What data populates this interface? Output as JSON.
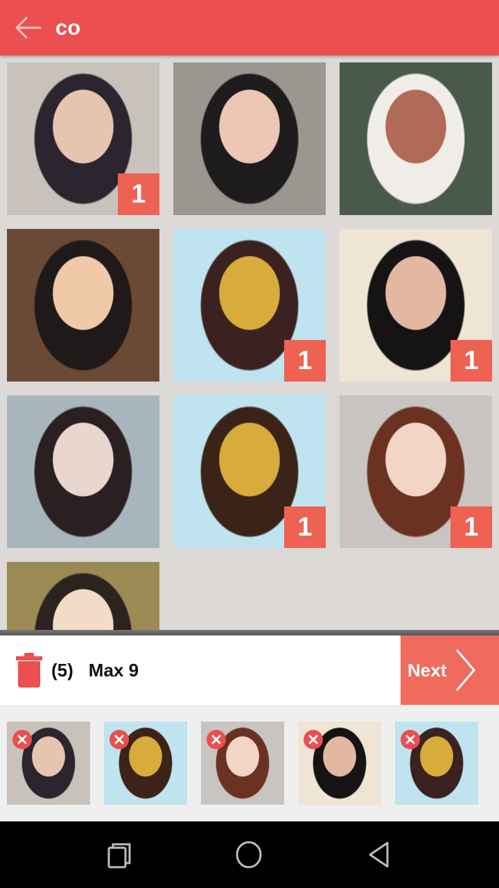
{
  "topbar": {
    "title": "co",
    "back_icon": "arrow-left-icon"
  },
  "grid": {
    "photos": [
      {
        "id": "photo-1",
        "selected_count": "1",
        "palette": [
          "#c9c2ba",
          "#2b2530",
          "#e7c4b0"
        ]
      },
      {
        "id": "photo-2",
        "selected_count": "",
        "palette": [
          "#9a9690",
          "#1e1b1c",
          "#ecc8b4"
        ]
      },
      {
        "id": "photo-3",
        "selected_count": "",
        "palette": [
          "#4a5a4a",
          "#f0ede8",
          "#b06a55"
        ]
      },
      {
        "id": "photo-4",
        "selected_count": "",
        "palette": [
          "#6b4a35",
          "#20191a",
          "#f0c9a8"
        ]
      },
      {
        "id": "photo-5",
        "selected_count": "1",
        "palette": [
          "#bfe3ef",
          "#3b2220",
          "#d8ac3a"
        ]
      },
      {
        "id": "photo-6",
        "selected_count": "1",
        "palette": [
          "#efe5d4",
          "#161314",
          "#e2b8a0"
        ]
      },
      {
        "id": "photo-7",
        "selected_count": "",
        "palette": [
          "#a9b5bd",
          "#2a2022",
          "#e9d6cf"
        ]
      },
      {
        "id": "photo-8",
        "selected_count": "1",
        "palette": [
          "#bfe3ef",
          "#3c2318",
          "#d8ac3a"
        ]
      },
      {
        "id": "photo-9",
        "selected_count": "1",
        "palette": [
          "#c8c4c2",
          "#6b3222",
          "#f2d5c4"
        ]
      },
      {
        "id": "photo-10",
        "selected_count": "",
        "palette": [
          "#9c8a55",
          "#2a2320",
          "#f2dcc8"
        ]
      }
    ]
  },
  "actionbar": {
    "delete_icon": "trash-icon",
    "selected_count": "(5)",
    "max_label": "Max 9",
    "next_label": "Next",
    "next_icon": "chevron-right-icon",
    "accent_color": "#ef6b5d"
  },
  "tray": {
    "selected": [
      {
        "id": "photo-1",
        "palette": [
          "#c9c2ba",
          "#2b2530",
          "#e7c4b0"
        ]
      },
      {
        "id": "photo-8",
        "palette": [
          "#bfe3ef",
          "#3c2318",
          "#d8ac3a"
        ]
      },
      {
        "id": "photo-9",
        "palette": [
          "#c8c4c2",
          "#6b3222",
          "#f2d5c4"
        ]
      },
      {
        "id": "photo-6",
        "palette": [
          "#efe5d4",
          "#161314",
          "#e2b8a0"
        ]
      },
      {
        "id": "photo-5",
        "palette": [
          "#bfe3ef",
          "#3b2220",
          "#d8ac3a"
        ]
      }
    ],
    "remove_icon": "close-icon"
  },
  "navbar": {
    "recents_icon": "recents-icon",
    "home_icon": "home-icon",
    "back_icon": "back-triangle-icon"
  },
  "colors": {
    "primary": "#eb4f50",
    "badge": "#ee6253",
    "grid_background": "#dcd9d6",
    "tray_background": "#efefef"
  }
}
